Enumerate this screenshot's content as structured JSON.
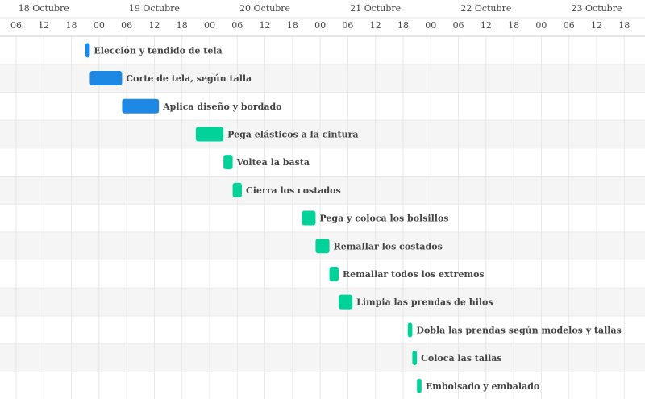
{
  "chart_data": {
    "type": "gantt",
    "title": "",
    "axis": {
      "day_labels": [
        {
          "date": "2020-10-18",
          "label": "18 Octubre"
        },
        {
          "date": "2020-10-19",
          "label": "19 Octubre"
        },
        {
          "date": "2020-10-20",
          "label": "20 Octubre"
        },
        {
          "date": "2020-10-21",
          "label": "21 Octubre"
        },
        {
          "date": "2020-10-22",
          "label": "22 Octubre"
        },
        {
          "date": "2020-10-23",
          "label": "23 Octubre"
        }
      ],
      "hour_ticks": [
        "06",
        "12",
        "18",
        "00"
      ],
      "x_range": [
        "2020-10-18T02:30",
        "2020-10-23T22:30"
      ],
      "grid": true
    },
    "colors": {
      "phase1": "#1e88e5",
      "phase2": "#00d29a",
      "row_alt": "#f5f5f5",
      "grid": "#e8e8e8",
      "axis_text": "#444444",
      "label_text": "#444444"
    },
    "tasks": [
      {
        "name": "Elección y tendido de tela",
        "start": "2020-10-18T21:00",
        "end": "2020-10-18T22:00",
        "color": "#1e88e5"
      },
      {
        "name": "Corte de tela, según talla",
        "start": "2020-10-18T22:00",
        "end": "2020-10-19T05:00",
        "color": "#1e88e5"
      },
      {
        "name": "Aplica diseño y bordado",
        "start": "2020-10-19T05:00",
        "end": "2020-10-19T13:00",
        "color": "#1e88e5"
      },
      {
        "name": "Pega elásticos a la cintura",
        "start": "2020-10-19T21:00",
        "end": "2020-10-20T03:00",
        "color": "#00d29a"
      },
      {
        "name": "Voltea la basta",
        "start": "2020-10-20T03:00",
        "end": "2020-10-20T05:00",
        "color": "#00d29a"
      },
      {
        "name": "Cierra los costados",
        "start": "2020-10-20T05:00",
        "end": "2020-10-20T07:00",
        "color": "#00d29a"
      },
      {
        "name": "Pega y coloca los bolsillos",
        "start": "2020-10-20T20:00",
        "end": "2020-10-20T23:00",
        "color": "#00d29a"
      },
      {
        "name": "Remallar los costados",
        "start": "2020-10-20T23:00",
        "end": "2020-10-21T02:00",
        "color": "#00d29a"
      },
      {
        "name": "Remallar todos los extremos",
        "start": "2020-10-21T02:00",
        "end": "2020-10-21T04:00",
        "color": "#00d29a"
      },
      {
        "name": "Limpia las prendas de hilos",
        "start": "2020-10-21T04:00",
        "end": "2020-10-21T07:00",
        "color": "#00d29a"
      },
      {
        "name": "Dobla las prendas según modelos y tallas",
        "start": "2020-10-21T19:00",
        "end": "2020-10-21T20:00",
        "color": "#00d29a"
      },
      {
        "name": "Coloca las tallas",
        "start": "2020-10-21T20:00",
        "end": "2020-10-21T21:00",
        "color": "#00d29a"
      },
      {
        "name": "Embolsado y embalado",
        "start": "2020-10-21T21:00",
        "end": "2020-10-21T22:00",
        "color": "#00d29a"
      }
    ]
  }
}
